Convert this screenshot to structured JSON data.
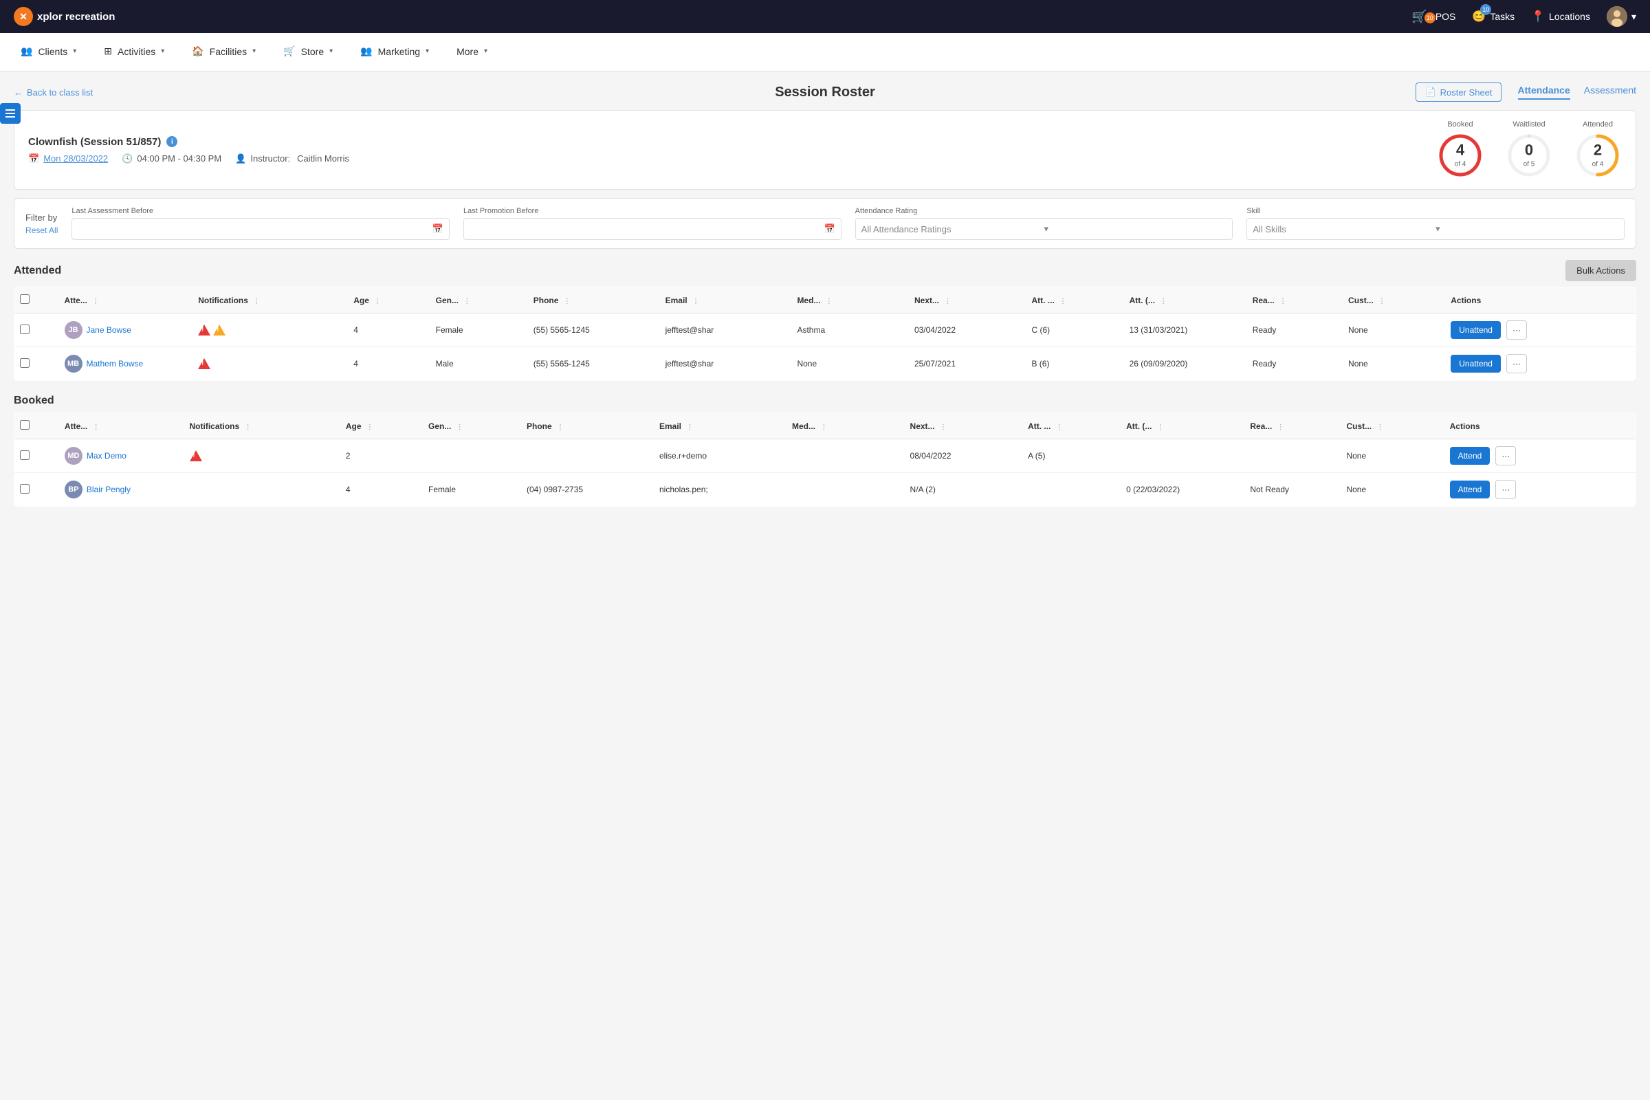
{
  "app": {
    "name": "xplor recreation",
    "logo_letter": "x"
  },
  "top_nav": {
    "pos_label": "POS",
    "pos_badge": "10",
    "tasks_label": "Tasks",
    "tasks_badge": "10",
    "locations_label": "Locations"
  },
  "main_nav": {
    "items": [
      {
        "id": "clients",
        "label": "Clients",
        "icon": "clients-icon"
      },
      {
        "id": "activities",
        "label": "Activities",
        "icon": "activities-icon"
      },
      {
        "id": "facilities",
        "label": "Facilities",
        "icon": "facilities-icon"
      },
      {
        "id": "store",
        "label": "Store",
        "icon": "store-icon"
      },
      {
        "id": "marketing",
        "label": "Marketing",
        "icon": "marketing-icon"
      },
      {
        "id": "more",
        "label": "More",
        "icon": "more-icon"
      }
    ]
  },
  "page": {
    "back_label": "Back to class list",
    "title": "Session Roster",
    "roster_sheet_label": "Roster Sheet",
    "tab_attendance": "Attendance",
    "tab_assessment": "Assessment"
  },
  "session": {
    "name": "Clownfish (Session 51/857)",
    "date": "Mon 28/03/2022",
    "time": "04:00 PM - 04:30 PM",
    "instructor_label": "Instructor:",
    "instructor": "Caitlin Morris"
  },
  "stats": {
    "booked_label": "Booked",
    "booked_number": "4",
    "booked_of": "of 4",
    "waitlisted_label": "Waitlisted",
    "waitlisted_number": "0",
    "waitlisted_of": "of 5",
    "attended_label": "Attended",
    "attended_number": "2",
    "attended_of": "of 4"
  },
  "filters": {
    "filter_by_label": "Filter by",
    "reset_label": "Reset All",
    "last_assessment_label": "Last Assessment Before",
    "last_promotion_label": "Last Promotion Before",
    "attendance_rating_label": "Attendance Rating",
    "attendance_rating_placeholder": "All Attendance Ratings",
    "skill_label": "Skill",
    "skill_placeholder": "All Skills"
  },
  "attended_section": {
    "title": "Attended",
    "bulk_actions_label": "Bulk Actions",
    "columns": [
      "",
      "Atte...",
      "Notifications",
      "Age",
      "Gen...",
      "Phone",
      "Email",
      "Med...",
      "Next...",
      "Att. ...",
      "Att. (...",
      "Rea...",
      "Cust...",
      "Actions"
    ],
    "rows": [
      {
        "id": "jane-bowse",
        "name": "Jane Bowse",
        "avatar_initials": "JB",
        "notifications": [
          "red",
          "yellow"
        ],
        "age": "4",
        "gender": "Female",
        "phone": "(55) 5565-1245",
        "email": "jefftest@shar",
        "medical": "Asthma",
        "next": "03/04/2022",
        "att": "C (6)",
        "att2": "13 (31/03/2021)",
        "ready": "Ready",
        "custom": "None",
        "action": "Unattend"
      },
      {
        "id": "mathew-bowse",
        "name": "Mathem Bowse",
        "avatar_initials": "MB",
        "notifications": [
          "red"
        ],
        "age": "4",
        "gender": "Male",
        "phone": "(55) 5565-1245",
        "email": "jefftest@shar",
        "medical": "None",
        "next": "25/07/2021",
        "att": "B (6)",
        "att2": "26 (09/09/2020)",
        "ready": "Ready",
        "custom": "None",
        "action": "Unattend"
      }
    ]
  },
  "booked_section": {
    "title": "Booked",
    "columns": [
      "",
      "Atte...",
      "Notifications",
      "Age",
      "Gen...",
      "Phone",
      "Email",
      "Med...",
      "Next...",
      "Att. ...",
      "Att. (...",
      "Rea...",
      "Cust...",
      "Actions"
    ],
    "rows": [
      {
        "id": "max-demo",
        "name": "Max Demo",
        "avatar_initials": "MD",
        "notifications": [
          "red"
        ],
        "age": "2",
        "gender": "",
        "phone": "",
        "email": "elise.r+demo",
        "medical": "",
        "next": "08/04/2022",
        "att": "A (5)",
        "att2": "",
        "ready": "",
        "custom": "None",
        "action": "Attend"
      },
      {
        "id": "blair-pengly",
        "name": "Blair Pengly",
        "avatar_initials": "BP",
        "notifications": [],
        "age": "4",
        "gender": "Female",
        "phone": "(04) 0987-2735",
        "email": "nicholas.pen;",
        "medical": "",
        "next": "N/A (2)",
        "att": "",
        "att2": "0 (22/03/2022)",
        "ready": "Not Ready",
        "custom": "None",
        "action": "Attend"
      }
    ]
  }
}
